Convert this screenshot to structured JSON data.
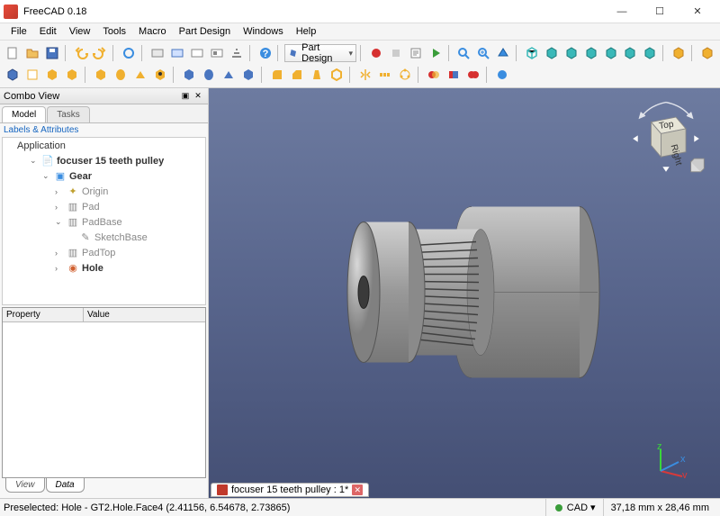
{
  "title": "FreeCAD 0.18",
  "menus": [
    "File",
    "Edit",
    "View",
    "Tools",
    "Macro",
    "Part Design",
    "Windows",
    "Help"
  ],
  "workbench": "Part Design",
  "combo": {
    "title": "Combo View",
    "tabs": [
      "Model",
      "Tasks"
    ],
    "tree_header": "Labels & Attributes",
    "root": "Application",
    "doc": "focuser 15 teeth pulley",
    "body": "Gear",
    "items": {
      "origin": "Origin",
      "pad": "Pad",
      "padbase": "PadBase",
      "sketchbase": "SketchBase",
      "padtop": "PadTop",
      "hole": "Hole"
    },
    "prop_cols": {
      "c1": "Property",
      "c2": "Value"
    },
    "prop_tabs": [
      "View",
      "Data"
    ]
  },
  "vp_tab": "focuser 15 teeth pulley : 1*",
  "navcube": {
    "top": "Top",
    "right": "Right"
  },
  "status": {
    "preselect": "Preselected: Hole - GT2.Hole.Face4 (2.41156, 6.54678, 2.73865)",
    "mode": "CAD",
    "dims": "37,18 mm x 28,46 mm"
  }
}
